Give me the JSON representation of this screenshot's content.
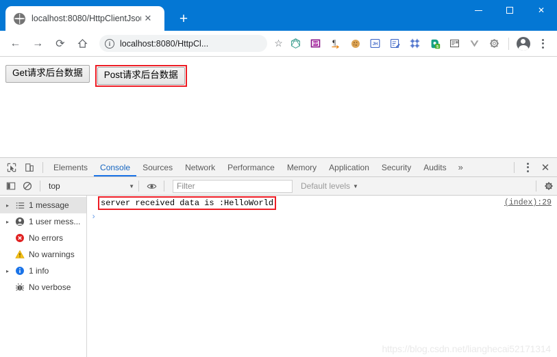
{
  "window": {
    "titlebar_color": "#0477d4",
    "minimize_label": "—",
    "maximize_label": "□",
    "close_label": "✕"
  },
  "tab": {
    "title": "localhost:8080/HttpClientJsou",
    "close_label": "✕",
    "favicon": "globe-icon",
    "newtab_label": "+"
  },
  "toolbar": {
    "back_label": "←",
    "forward_label": "→",
    "reload_label": "⟳",
    "home_label": "⌂",
    "omnibox_value": "localhost:8080/HttpCl...",
    "info_label": "i",
    "star_label": "☆",
    "extensions": [
      {
        "name": "graphql-extension-icon",
        "label": ""
      },
      {
        "name": "rp-extension-icon",
        "label": "RP"
      },
      {
        "name": "pilcrow-extension-icon",
        "label": "¶"
      },
      {
        "name": "cookie-extension-icon",
        "label": ""
      },
      {
        "name": "jh-extension-icon",
        "label": "JH"
      },
      {
        "name": "form-edit-extension-icon",
        "label": ""
      },
      {
        "name": "frame-grid-extension-icon",
        "label": ""
      },
      {
        "name": "evernote-extension-icon",
        "label": "e",
        "badge": "5"
      },
      {
        "name": "note-capture-extension-icon",
        "label": ""
      },
      {
        "name": "vue-devtools-extension-icon",
        "label": "V"
      },
      {
        "name": "gear-extension-icon",
        "label": ""
      }
    ],
    "profile_label": "profile-avatar",
    "menu_label": "chrome-menu"
  },
  "page": {
    "get_button_label": "Get请求后台数据",
    "post_button_label": "Post请求后台数据",
    "annotation_color": "#ed1c24"
  },
  "devtools": {
    "inspect_icon": "inspect-element-icon",
    "device_icon": "device-toolbar-icon",
    "tabs": [
      {
        "label": "Elements",
        "active": false
      },
      {
        "label": "Console",
        "active": true
      },
      {
        "label": "Sources",
        "active": false
      },
      {
        "label": "Network",
        "active": false
      },
      {
        "label": "Performance",
        "active": false
      },
      {
        "label": "Memory",
        "active": false
      },
      {
        "label": "Application",
        "active": false
      },
      {
        "label": "Security",
        "active": false
      },
      {
        "label": "Audits",
        "active": false
      }
    ],
    "overflow_label": "»",
    "menu_label": "⋮",
    "close_label": "✕",
    "console_toolbar": {
      "sidebar_toggle": "console-sidebar-toggle-icon",
      "clear_label": "clear-console-icon",
      "context_value": "top",
      "context_caret": "▼",
      "eye_label": "live-expression-icon",
      "filter_placeholder": "Filter",
      "levels_label": "Default levels",
      "levels_caret": "▼",
      "settings_label": "settings-gear-icon"
    },
    "sidebar": [
      {
        "label": "1 message",
        "icon": "list-icon",
        "expandable": true,
        "selected": true
      },
      {
        "label": "1 user mess...",
        "icon": "user-icon",
        "expandable": true,
        "selected": false
      },
      {
        "label": "No errors",
        "icon": "error-icon",
        "expandable": false,
        "selected": false
      },
      {
        "label": "No warnings",
        "icon": "warning-icon",
        "expandable": false,
        "selected": false
      },
      {
        "label": "1 info",
        "icon": "info-icon",
        "expandable": true,
        "selected": false
      },
      {
        "label": "No verbose",
        "icon": "verbose-bug-icon",
        "expandable": false,
        "selected": false
      }
    ],
    "messages": [
      {
        "text": "server received data is :HelloWorld",
        "source": "(index):29",
        "highlighted": true
      }
    ],
    "prompt_symbol": "›"
  },
  "watermark": {
    "text": "https://blog.csdn.net/lianghecai52171314"
  }
}
